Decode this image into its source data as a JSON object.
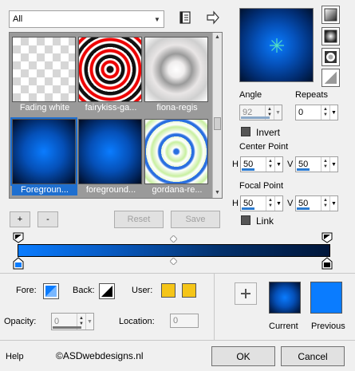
{
  "category_select": {
    "value": "All"
  },
  "gallery": {
    "items": [
      {
        "label": "Fading white"
      },
      {
        "label": "fairykiss-ga..."
      },
      {
        "label": "fiona-regis"
      },
      {
        "label": "Foregroun..."
      },
      {
        "label": "foreground..."
      },
      {
        "label": "gordana-re..."
      }
    ]
  },
  "toolbar": {
    "add_label": "+",
    "remove_label": "-",
    "reset_label": "Reset",
    "save_label": "Save"
  },
  "angle": {
    "label": "Angle",
    "value": "92"
  },
  "repeats": {
    "label": "Repeats",
    "value": "0"
  },
  "invert": {
    "label": "Invert"
  },
  "center_point": {
    "label": "Center Point",
    "h_label": "H",
    "h_value": "50",
    "v_label": "V",
    "v_value": "50"
  },
  "focal_point": {
    "label": "Focal Point",
    "h_label": "H",
    "h_value": "50",
    "v_label": "V",
    "v_value": "50"
  },
  "link": {
    "label": "Link"
  },
  "bottom": {
    "fore_label": "Fore:",
    "back_label": "Back:",
    "user_label": "User:",
    "opacity_label": "Opacity:",
    "opacity_value": "0",
    "location_label": "Location:",
    "location_value": "0",
    "current_label": "Current",
    "previous_label": "Previous"
  },
  "footer": {
    "help_label": "Help",
    "watermark": "©ASDwebdesigns.nl",
    "ok_label": "OK",
    "cancel_label": "Cancel"
  },
  "colors": {
    "accent_blue": "#0a7cff",
    "user_swatch": "#f5c518",
    "gradient_dark": "#00163a"
  }
}
